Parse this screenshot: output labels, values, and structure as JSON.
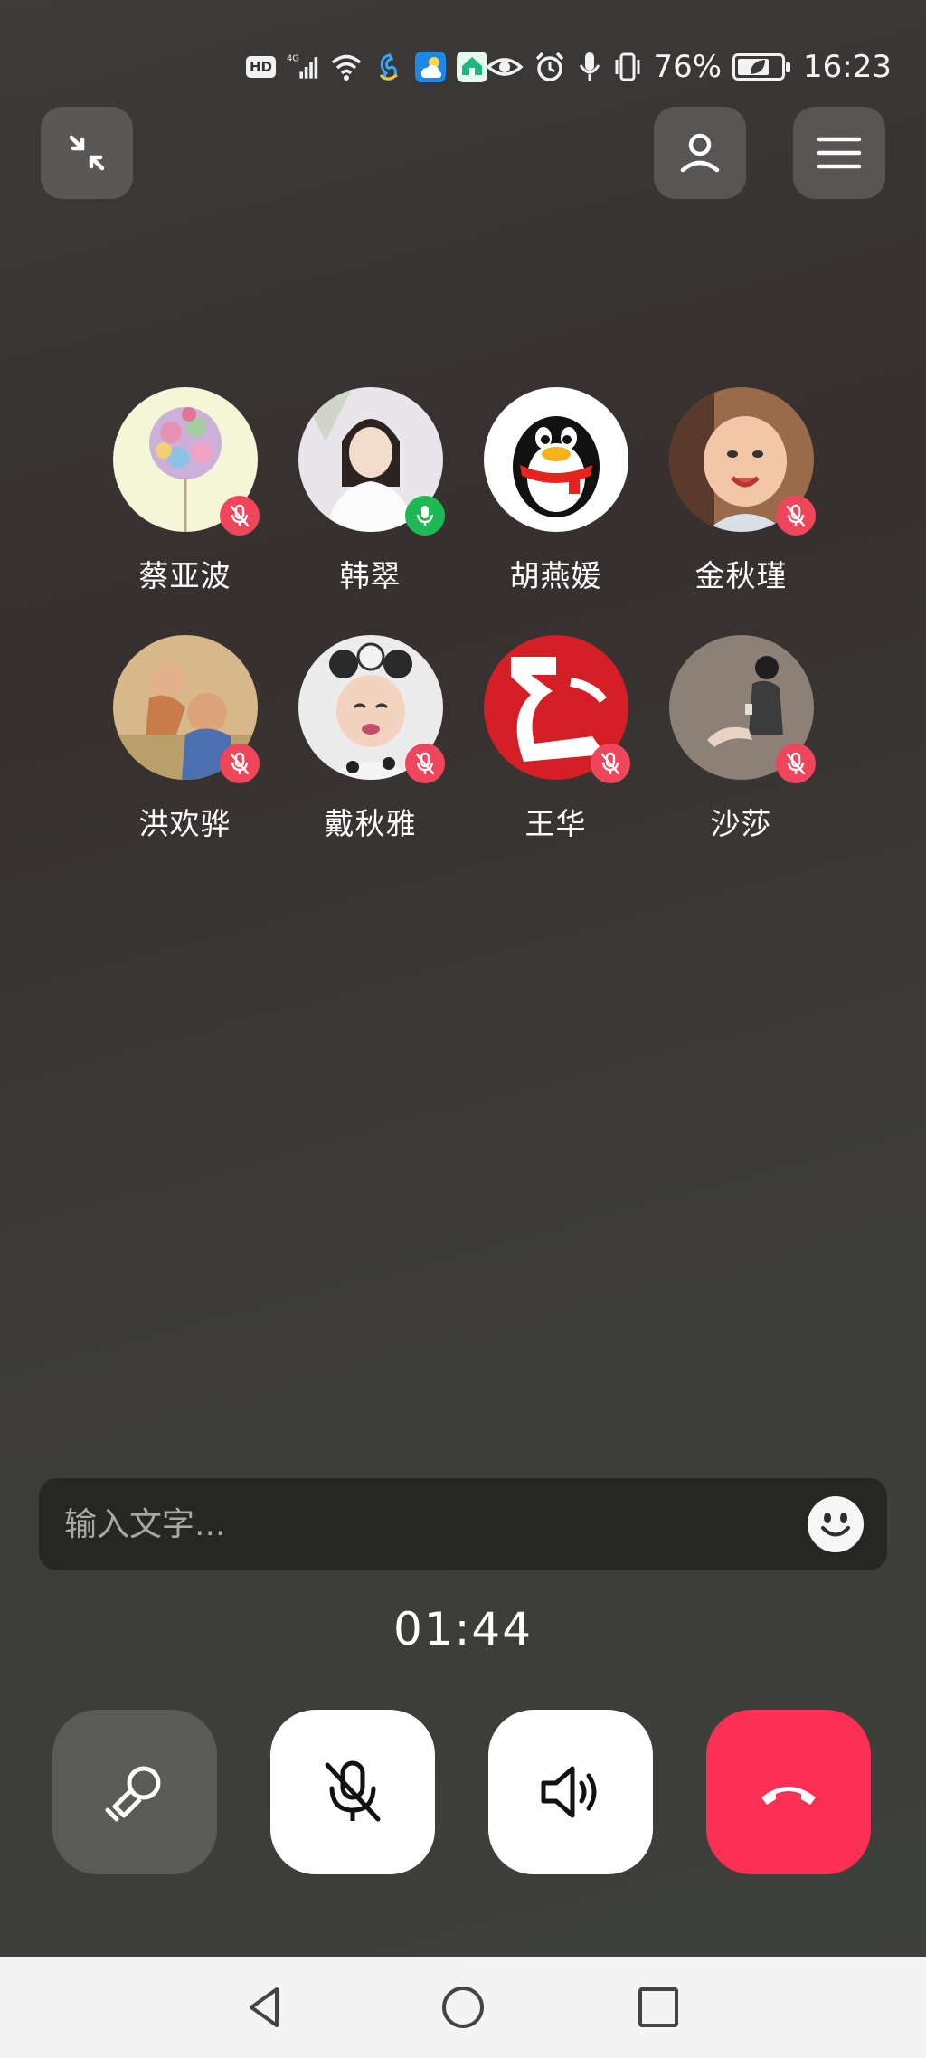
{
  "status_bar": {
    "hd": "HD",
    "network": "4G",
    "battery_percent": "76%",
    "battery_level": 0.76,
    "time": "16:23"
  },
  "top_bar": {
    "minimize_icon": "collapse-arrows-icon",
    "profile_icon": "person-icon",
    "menu_icon": "hamburger-menu-icon"
  },
  "participants": [
    {
      "name": "蔡亚波",
      "mic": "muted",
      "avatar_color": "#f3f7d8"
    },
    {
      "name": "韩翠",
      "mic": "active",
      "avatar_color": "#e8e6ea"
    },
    {
      "name": "胡燕媛",
      "mic": "none",
      "avatar_color": "#ffffff"
    },
    {
      "name": "金秋瑾",
      "mic": "muted",
      "avatar_color": "#9a6a4a"
    },
    {
      "name": "洪欢骅",
      "mic": "muted",
      "avatar_color": "#d8b88a"
    },
    {
      "name": "戴秋雅",
      "mic": "muted",
      "avatar_color": "#ececec"
    },
    {
      "name": "王华",
      "mic": "muted",
      "avatar_color": "#d51f26"
    },
    {
      "name": "沙莎",
      "mic": "muted",
      "avatar_color": "#8c8077"
    }
  ],
  "input": {
    "placeholder": "输入文字...",
    "value": "",
    "emoji_icon": "smiley-icon"
  },
  "timer": "01:44",
  "controls": {
    "effects_icon": "magic-wand-icon",
    "mute_icon": "mic-off-icon",
    "speaker_icon": "speaker-icon",
    "hangup_icon": "phone-hangup-icon",
    "hangup_color": "#fb3054"
  },
  "nav": {
    "back_icon": "triangle-back-icon",
    "home_icon": "circle-home-icon",
    "recent_icon": "square-recents-icon"
  }
}
